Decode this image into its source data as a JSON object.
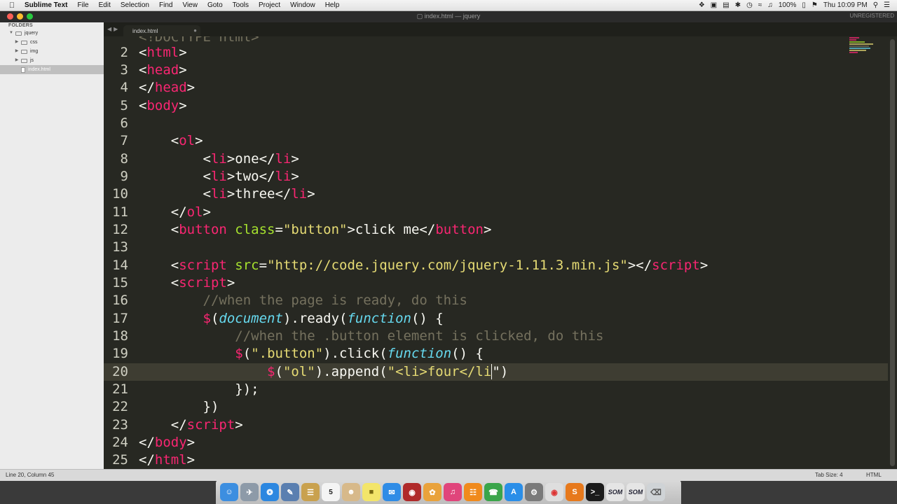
{
  "menubar": {
    "app_name": "Sublime Text",
    "items": [
      "File",
      "Edit",
      "Selection",
      "Find",
      "View",
      "Goto",
      "Tools",
      "Project",
      "Window",
      "Help"
    ],
    "battery": "100%",
    "clock": "Thu 10:09 PM"
  },
  "window": {
    "title": "index.html — jquery",
    "unregistered": "UNREGISTERED"
  },
  "sidebar": {
    "header": "FOLDERS",
    "root": "jquery",
    "folders": [
      "css",
      "img",
      "js"
    ],
    "file": "index.html"
  },
  "tab": {
    "label": "index.html"
  },
  "editor": {
    "partial_first_line": "!DOCTYPE html",
    "line_numbers": [
      "2",
      "3",
      "4",
      "5",
      "6",
      "7",
      "8",
      "9",
      "10",
      "11",
      "12",
      "13",
      "14",
      "15",
      "16",
      "17",
      "18",
      "19",
      "20",
      "21",
      "22",
      "23",
      "24",
      "25"
    ],
    "lines": {
      "l2": [
        "<",
        "html",
        ">"
      ],
      "l3": [
        "<",
        "head",
        ">"
      ],
      "l4": [
        "</",
        "head",
        ">"
      ],
      "l5": [
        "<",
        "body",
        ">"
      ],
      "l7": [
        "    <",
        "ol",
        ">"
      ],
      "l8": [
        "        <",
        "li",
        ">one</",
        "li",
        ">"
      ],
      "l9": [
        "        <",
        "li",
        ">two</",
        "li",
        ">"
      ],
      "l10": [
        "        <",
        "li",
        ">three</",
        "li",
        ">"
      ],
      "l11": [
        "    </",
        "ol",
        ">"
      ],
      "l12": [
        "    <",
        "button",
        " ",
        "class",
        "=",
        "\"button\"",
        ">click me</",
        "button",
        ">"
      ],
      "l14": [
        "    <",
        "script",
        " ",
        "src",
        "=",
        "\"http://code.jquery.com/jquery-1.11.3.min.js\"",
        "></",
        "script",
        ">"
      ],
      "l15": [
        "    <",
        "script",
        ">"
      ],
      "l16": "        //when the page is ready, do this",
      "l17": [
        "        ",
        "$",
        "(",
        "document",
        ").ready(",
        "function",
        "() {"
      ],
      "l18": "            //when the .button element is clicked, do this",
      "l19": [
        "            ",
        "$",
        "(",
        "\".button\"",
        ").click(",
        "function",
        "() {"
      ],
      "l20": [
        "                ",
        "$",
        "(",
        "\"ol\"",
        ").append(",
        "\"<li>four</li",
        "\")"
      ],
      "l21": "            });",
      "l22": "        })",
      "l23": [
        "    </",
        "script",
        ">"
      ],
      "l24": [
        "</",
        "body",
        ">"
      ],
      "l25": [
        "</",
        "html",
        ">"
      ]
    }
  },
  "statusbar": {
    "position": "Line 20, Column 45",
    "tab_size": "Tab Size: 4",
    "syntax": "HTML"
  },
  "dock": {
    "apps": [
      "finder",
      "launchpad",
      "safari",
      "preview",
      "notes",
      "calendar",
      "contacts",
      "stickies",
      "messages-blue",
      "photo-booth",
      "photos",
      "itunes",
      "ibooks",
      "facetime",
      "app-store",
      "system-preferences",
      "chrome",
      "sublime-text",
      "terminal",
      "som",
      "som-2",
      "trash"
    ],
    "calendar_day": "5",
    "som_label": "SOM"
  },
  "colors": {
    "bg": "#272822",
    "tag": "#f92672",
    "attr": "#a6e22e",
    "string": "#e6db74",
    "comment": "#75715e",
    "keyword": "#66d9ef",
    "text": "#f8f8f2"
  }
}
